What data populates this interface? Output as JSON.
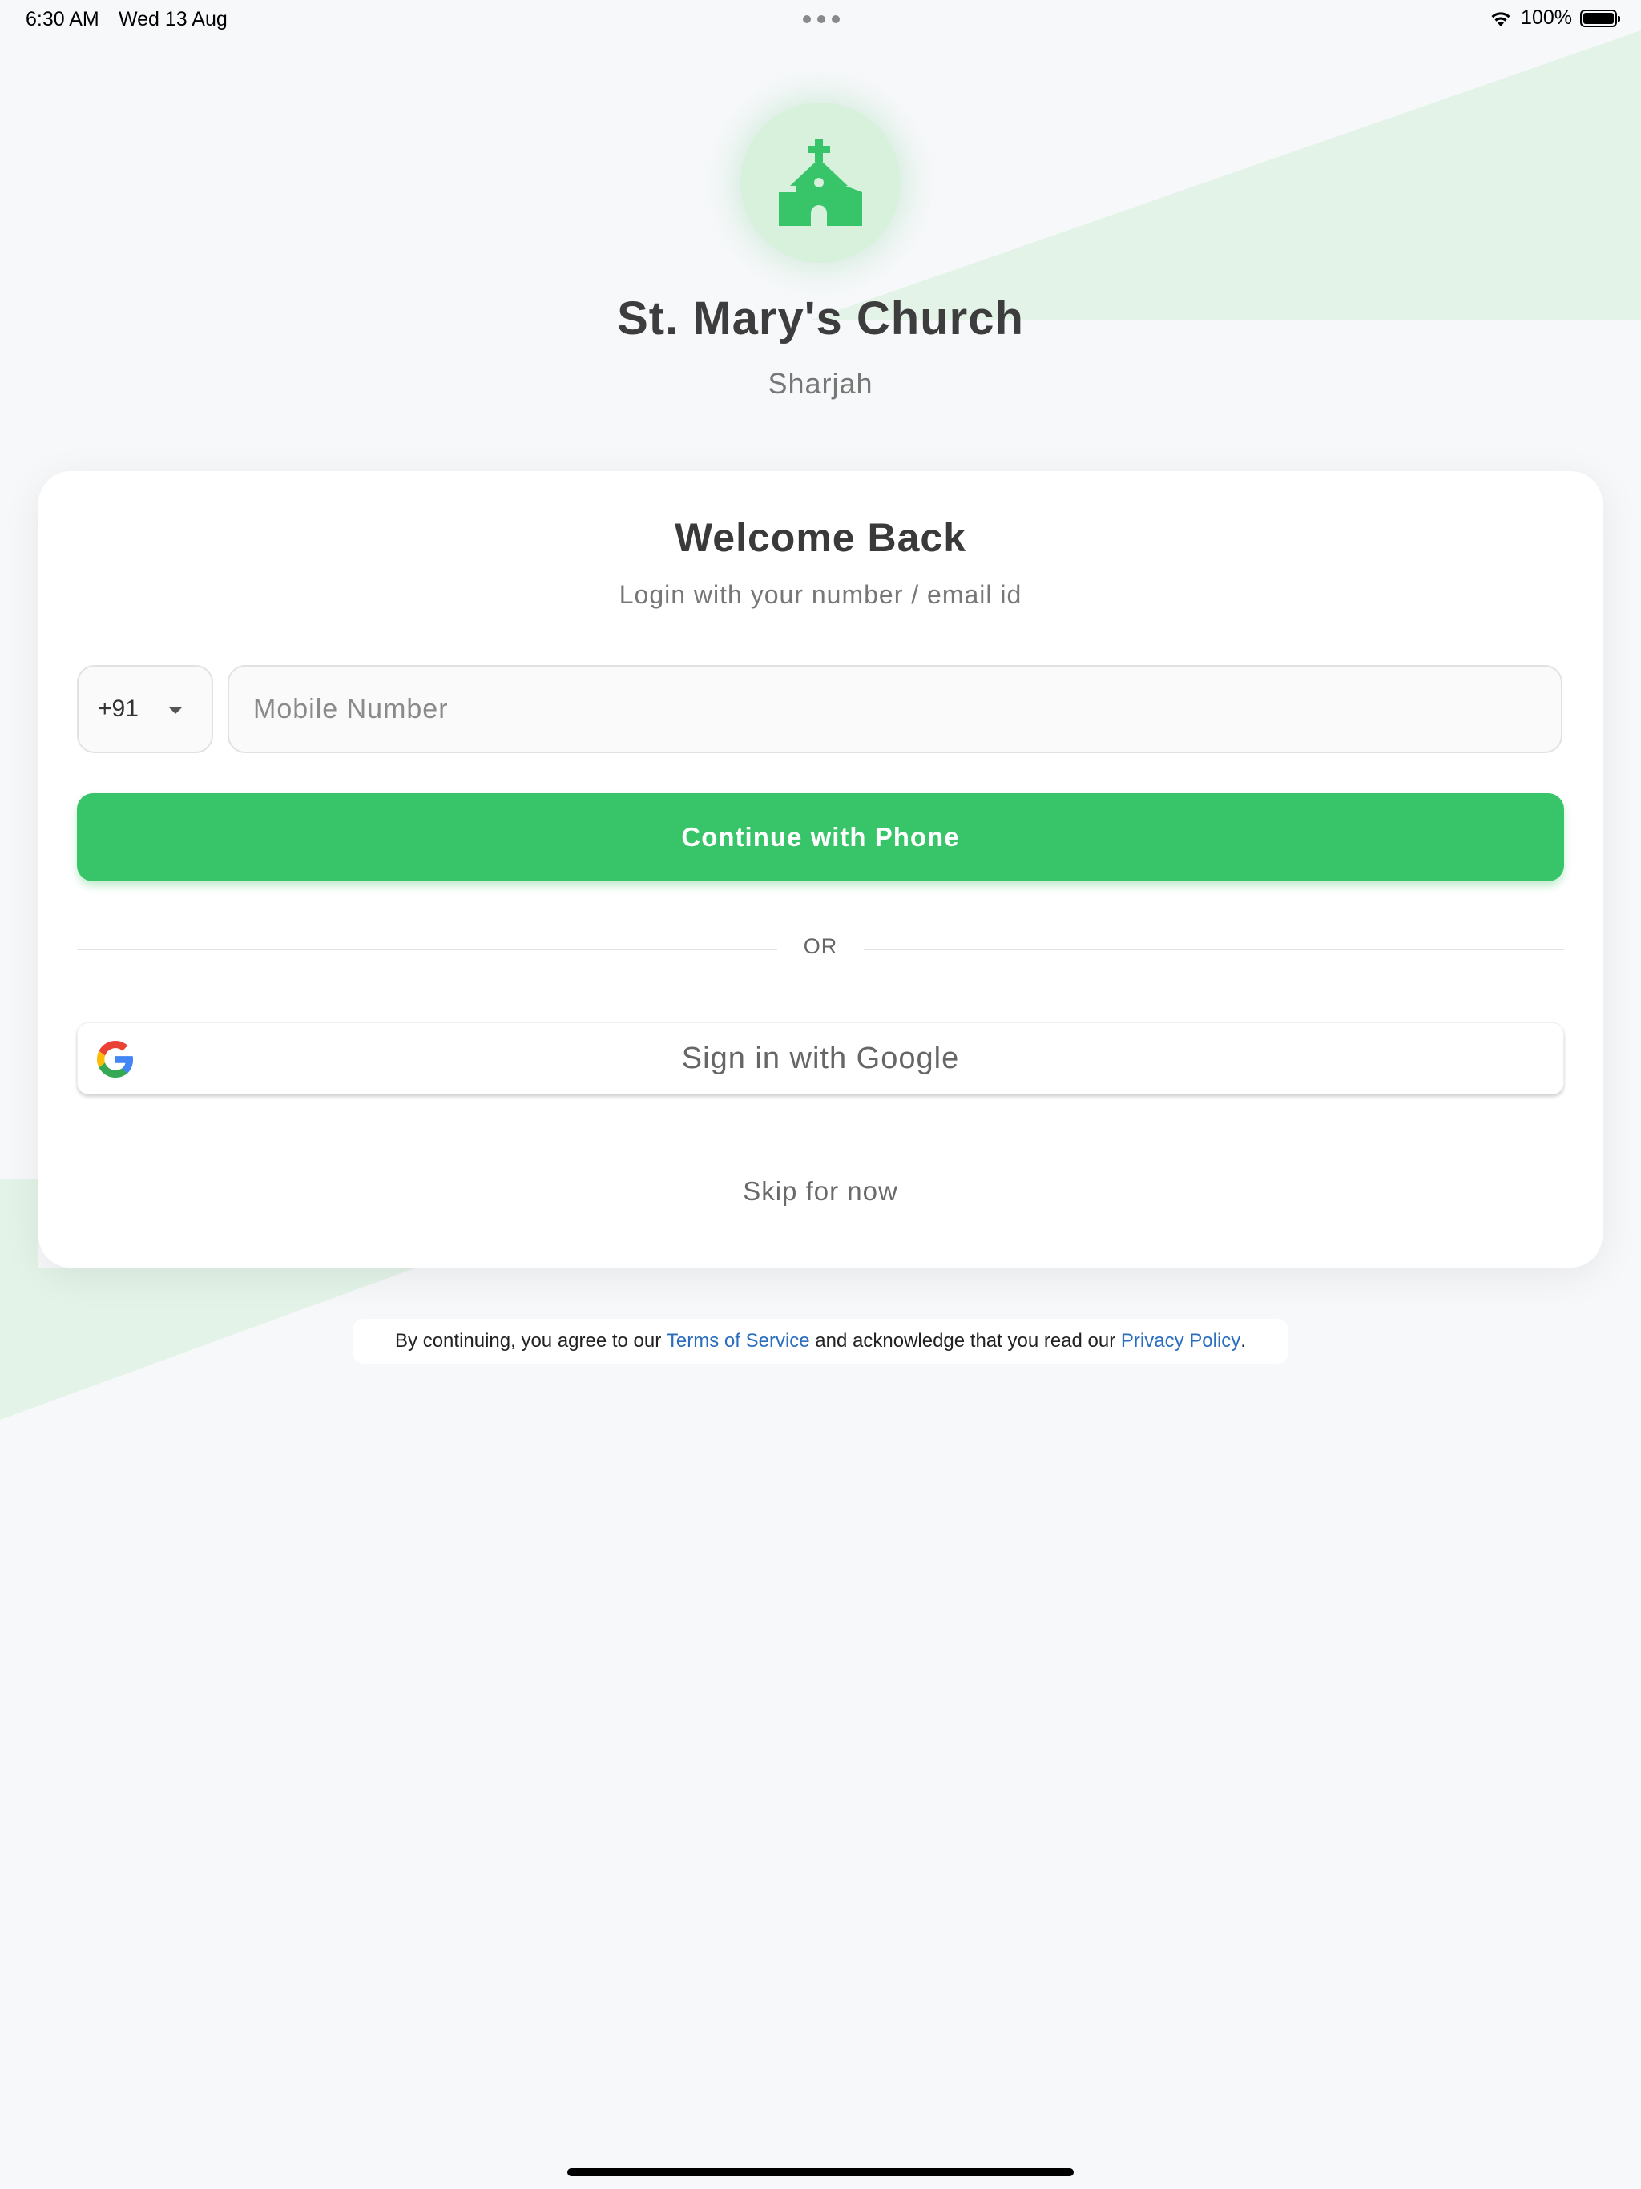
{
  "status_bar": {
    "time": "6:30 AM",
    "date": "Wed 13 Aug",
    "battery": "100%"
  },
  "header": {
    "church_name": "St. Mary's Church",
    "location": "Sharjah",
    "logo_icon": "church-icon"
  },
  "login": {
    "title": "Welcome Back",
    "subtitle": "Login with your number / email id",
    "country_code": "+91",
    "mobile_placeholder": "Mobile Number",
    "mobile_value": "",
    "continue_label": "Continue with Phone",
    "or_label": "OR",
    "google_label": "Sign in with Google",
    "skip_label": "Skip for now"
  },
  "terms": {
    "prefix": "By continuing, you agree to our ",
    "terms_link": "Terms of Service",
    "middle": " and acknowledge that you read our ",
    "privacy_link": "Privacy Policy",
    "suffix": "."
  },
  "colors": {
    "accent": "#38c468",
    "background": "#f7f8fa",
    "link": "#2a6ebd",
    "logo_bg": "#d7f1dd"
  }
}
